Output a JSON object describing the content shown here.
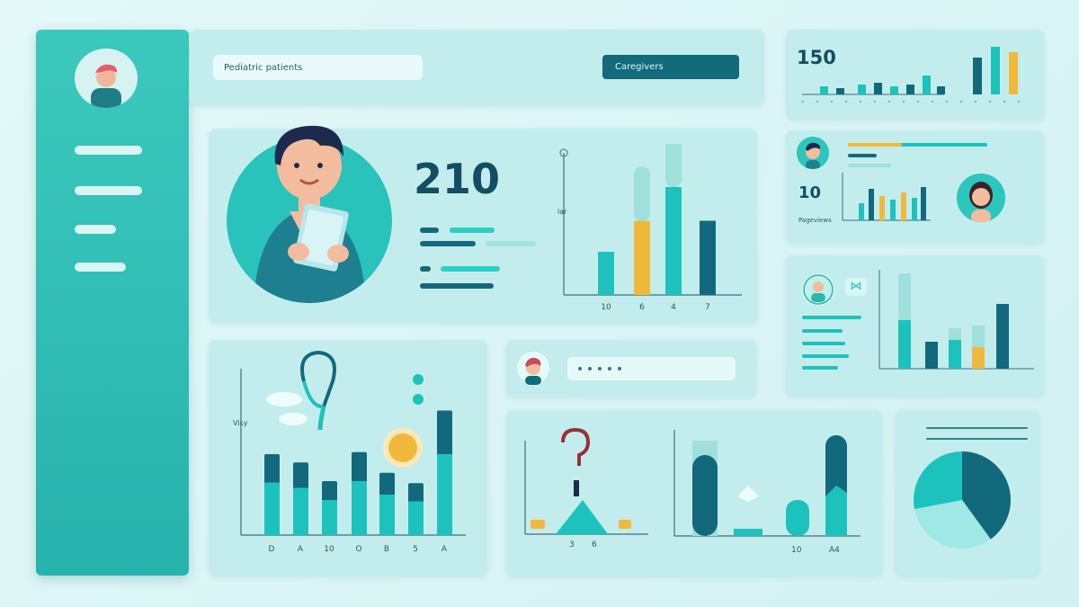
{
  "search": {
    "text": "Pediatric patients"
  },
  "header": {
    "button_label": "Caregivers"
  },
  "hero": {
    "stat_value": "210",
    "axis_label": "lar",
    "bar_ticks": [
      "10",
      "6",
      "4",
      "7"
    ]
  },
  "top_right": {
    "stat_value": "150"
  },
  "mid_right": {
    "stat_value": "10",
    "caption": "Pageviews"
  },
  "bottom_left": {
    "axis_label": "Visy",
    "ticks": [
      "D",
      "A",
      "10",
      "O",
      "B",
      "5",
      "A"
    ]
  },
  "bottom_middle": {
    "ticks_a": [
      "3",
      "6"
    ],
    "ticks_b": [
      "10",
      "A4"
    ]
  },
  "colors": {
    "teal": "#1ec2bd",
    "dark_teal": "#13697c",
    "yellow": "#f1b93b",
    "panel": "#c3eded",
    "sidebar": "#2fbdb5"
  },
  "chart_data": [
    {
      "type": "bar",
      "categories": [
        "10",
        "6",
        "4",
        "7"
      ],
      "values": [
        32,
        55,
        80,
        55
      ],
      "ylim": [
        0,
        100
      ]
    },
    {
      "type": "bar",
      "categories": [
        "D",
        "A",
        "10",
        "O",
        "B",
        "5",
        "A"
      ],
      "values": [
        78,
        70,
        52,
        80,
        60,
        50,
        120
      ],
      "ylim": [
        0,
        130
      ]
    },
    {
      "type": "pie",
      "values": [
        40,
        32,
        28
      ]
    }
  ]
}
